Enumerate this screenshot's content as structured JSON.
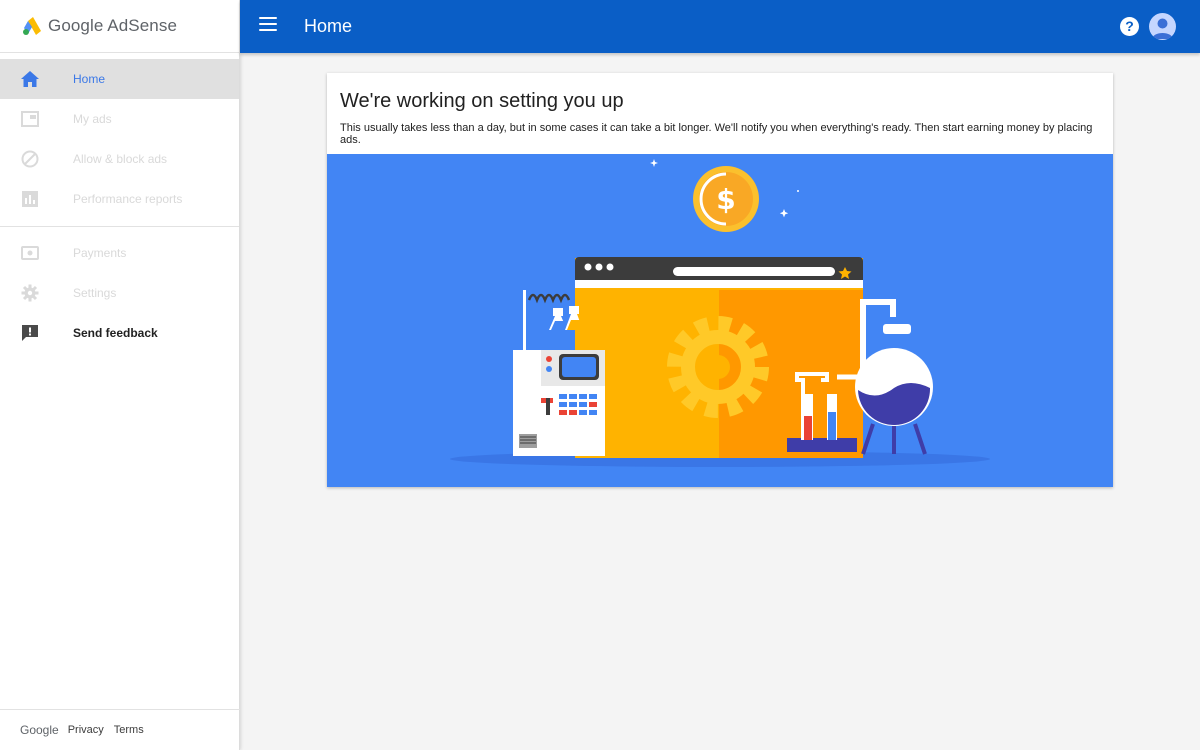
{
  "brand": {
    "name": "Google AdSense"
  },
  "topbar": {
    "title": "Home"
  },
  "sidebar": {
    "items": [
      {
        "label": "Home",
        "icon": "home-icon",
        "state": "active"
      },
      {
        "label": "My ads",
        "icon": "ad-unit-icon",
        "state": "disabled"
      },
      {
        "label": "Allow & block ads",
        "icon": "block-icon",
        "state": "disabled"
      },
      {
        "label": "Performance reports",
        "icon": "bar-chart-icon",
        "state": "disabled"
      },
      {
        "label": "Payments",
        "icon": "payment-icon",
        "state": "disabled"
      },
      {
        "label": "Settings",
        "icon": "gear-icon",
        "state": "disabled"
      },
      {
        "label": "Send feedback",
        "icon": "feedback-icon",
        "state": "enabled"
      }
    ]
  },
  "footer": {
    "google": "Google",
    "privacy": "Privacy",
    "terms": "Terms"
  },
  "card": {
    "title": "We're working on setting you up",
    "subtitle": "This usually takes less than a day, but in some cases it can take a bit longer. We'll notify you when everything's ready. Then start earning money by placing ads.",
    "coin_symbol": "$"
  },
  "colors": {
    "topbar": "#0a5ec6",
    "accent": "#3b78e7",
    "illustration_bg": "#4285f4",
    "browser_yellow": "#ffb300",
    "coin": "#fbc02d"
  }
}
